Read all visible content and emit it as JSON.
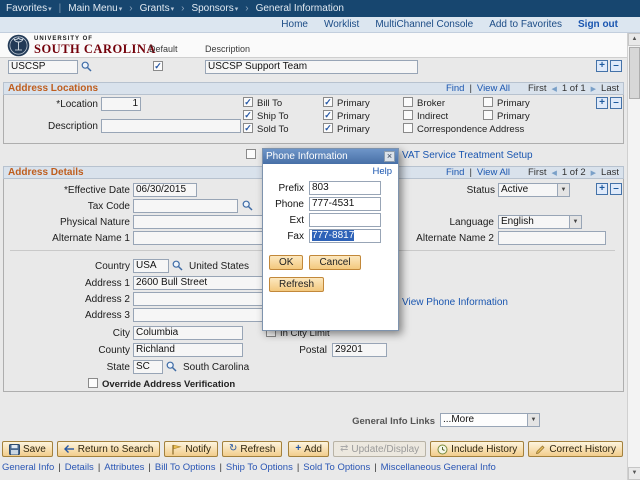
{
  "icons": {
    "check": "✓",
    "dropdown_arrow": "▼",
    "menu_caret": "▾",
    "breadcrumb_chevron": "›",
    "prev_arrow": "◀",
    "next_arrow": "▶",
    "scroll_up": "▲",
    "scroll_down": "▼",
    "plus": "+",
    "minus": "–",
    "refresh_glyph": "↻",
    "update_glyph": "⇄",
    "close": "×"
  },
  "separators": {
    "pipe": "|"
  },
  "colors": {
    "topnav_bg": "#17466f",
    "utility_bg": "#dce6f0",
    "link_blue": "#1a56b0",
    "section_title_orange": "#bf5e1e",
    "garnet": "#73000a",
    "button_tan": "#f2cd8c",
    "modal_titlebar_blue": "#476fa6",
    "selection_blue": "#2e62b8"
  },
  "topnav": {
    "favorites_label": "Favorites",
    "main_menu_label": "Main Menu",
    "breadcrumbs": [
      "Grants",
      "Sponsors",
      "General Information"
    ]
  },
  "utility_nav": {
    "links": [
      "Home",
      "Worklist",
      "MultiChannel Console",
      "Add to Favorites"
    ],
    "sign_out_label": "Sign out"
  },
  "logo": {
    "line1": "UNIVERSITY OF",
    "line2": "SOUTH CAROLINA"
  },
  "sponsor_grid": {
    "default_header_fragment": "Default",
    "description_header_fragment": "Description",
    "id_value": "USCSP",
    "default_checked": true,
    "description_value": "USCSP Support Team"
  },
  "address_locations": {
    "title": "Address Locations",
    "find_label": "Find",
    "view_all_label": "View All",
    "first_label": "First",
    "position_text": "1 of 1",
    "last_label": "Last",
    "location_label": "*Location",
    "location_value": "1",
    "description_label": "Description",
    "description_value": "",
    "checkbox_grid": [
      {
        "label": "Bill To",
        "checked": true
      },
      {
        "label": "Primary",
        "checked": true
      },
      {
        "label": "Broker",
        "checked": false
      },
      {
        "label": "Primary",
        "checked": false
      },
      {
        "label": "Ship To",
        "checked": true
      },
      {
        "label": "Primary",
        "checked": true
      },
      {
        "label": "Indirect",
        "checked": false
      },
      {
        "label": "Primary",
        "checked": false
      },
      {
        "label": "Sold To",
        "checked": true
      },
      {
        "label": "Primary",
        "checked": true
      },
      {
        "label": "Correspondence Address",
        "checked": false
      }
    ],
    "vat_link_label": "VAT Service Treatment Setup"
  },
  "address_details": {
    "title": "Address Details",
    "find_label": "Find",
    "view_all_label": "View All",
    "first_label": "First",
    "position_text": "1 of 2",
    "last_label": "Last",
    "effective_date_label": "*Effective Date",
    "effective_date_value": "06/30/2015",
    "status_label": "Status",
    "status_value": "Active",
    "tax_code_label": "Tax Code",
    "physical_nature_label": "Physical Nature",
    "physical_nature_value": "",
    "language_label": "Language",
    "language_value": "English",
    "alternate_name1_label": "Alternate Name 1",
    "alternate_name1_value": "",
    "alternate_name2_label": "Alternate Name 2",
    "alternate_name2_value": "",
    "country_label": "Country",
    "country_value": "USA",
    "country_name": "United States",
    "address1_label": "Address 1",
    "address1_value": "2600 Bull Street",
    "address2_label": "Address 2",
    "address2_value": "",
    "address3_label": "Address 3",
    "address3_value": "",
    "city_label": "City",
    "city_value": "Columbia",
    "in_city_limit_label": "In City Limit",
    "in_city_limit_checked": false,
    "county_label": "County",
    "county_value": "Richland",
    "postal_label": "Postal",
    "postal_value": "29201",
    "state_label": "State",
    "state_value": "SC",
    "state_name": "South Carolina",
    "override_label": "Override Address Verification",
    "override_checked": false,
    "view_phone_link": "View Phone Information"
  },
  "general_info_links": {
    "label": "General Info Links",
    "value": "...More"
  },
  "toolbar": {
    "save": "Save",
    "return_to_search": "Return to Search",
    "notify": "Notify",
    "refresh": "Refresh",
    "add": "Add",
    "update_display": "Update/Display",
    "include_history": "Include History",
    "correct_history": "Correct History"
  },
  "footer_links": [
    "General Info",
    "Details",
    "Attributes",
    "Bill To Options",
    "Ship To Options",
    "Sold To Options",
    "Miscellaneous General Info"
  ],
  "modal": {
    "title": "Phone Information",
    "help_label": "Help",
    "fields": [
      {
        "label": "Prefix",
        "value": "803"
      },
      {
        "label": "Phone",
        "value": "777-4531"
      },
      {
        "label": "Ext",
        "value": ""
      },
      {
        "label": "Fax",
        "value": "777-8817"
      }
    ],
    "ok_label": "OK",
    "cancel_label": "Cancel",
    "refresh_label": "Refresh"
  }
}
